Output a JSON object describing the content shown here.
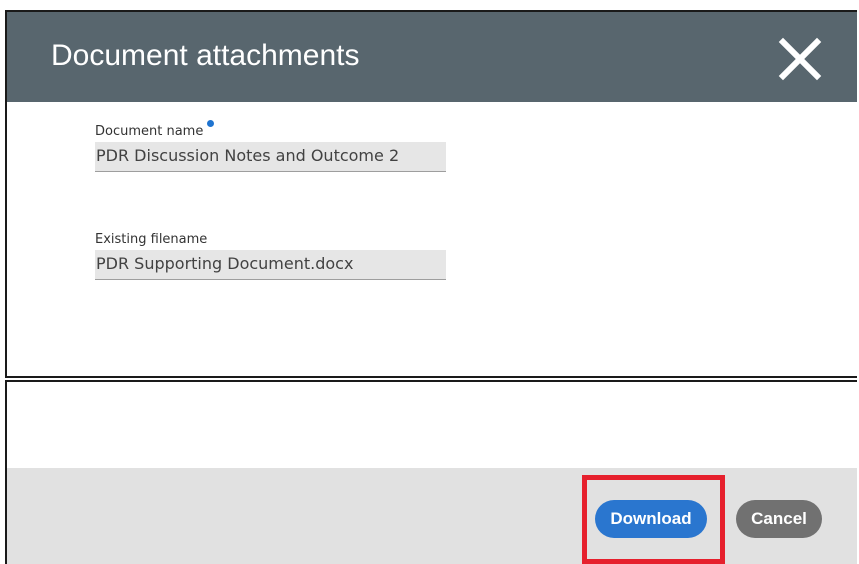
{
  "dialog": {
    "title": "Document attachments",
    "close_icon": "close-icon"
  },
  "fields": {
    "document_name": {
      "label": "Document name",
      "value": "PDR Discussion Notes and Outcome 2",
      "required": true
    },
    "existing_filename": {
      "label": "Existing filename",
      "value": "PDR Supporting Document.docx"
    }
  },
  "footer": {
    "download_label": "Download",
    "cancel_label": "Cancel"
  },
  "colors": {
    "header_bg": "#58666e",
    "primary_button": "#2a76cf",
    "secondary_button": "#717171",
    "required_dot": "#1f74d0",
    "highlight": "#e6202d"
  }
}
